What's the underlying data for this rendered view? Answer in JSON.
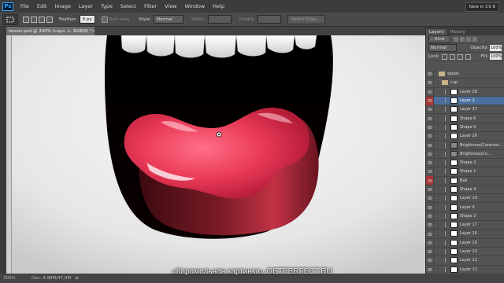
{
  "menu": {
    "logo": "Ps",
    "items": [
      "File",
      "Edit",
      "Image",
      "Layer",
      "Type",
      "Select",
      "Filter",
      "View",
      "Window",
      "Help"
    ],
    "new_in": "New in CS 6"
  },
  "options": {
    "feather_label": "Feather:",
    "feather_value": "0 px",
    "antialias_label": "Anti-alias",
    "style_label": "Style:",
    "style_value": "Normal",
    "width_label": "Width:",
    "height_label": "Height:",
    "refine_edge": "Refine Edge..."
  },
  "document": {
    "tab_title": "lesson.psd @ 300% (cup+ +, RGB/8) *",
    "close": "×"
  },
  "status": {
    "zoom": "300%",
    "doc_size": "Doc: 4,98M/47,0M",
    "arrow": "▶"
  },
  "caption": "«Карамельная картинка» GETPERFECT.RU",
  "panel": {
    "tabs": [
      "Layers",
      "History"
    ],
    "kind_label": "Kind",
    "blend_mode": "Normal",
    "opacity_label": "Opacity:",
    "opacity_value": "100%",
    "lock_label": "Lock:",
    "fill_label": "Fill:",
    "fill_value": "100%",
    "layers": [
      {
        "name": "spoon",
        "type": "folder"
      },
      {
        "name": "cup",
        "type": "folder"
      },
      {
        "name": "Layer 28",
        "type": "layer"
      },
      {
        "name": "Layer 2",
        "type": "layer",
        "selected": true
      },
      {
        "name": "Layer 27",
        "type": "layer"
      },
      {
        "name": "Shape 6",
        "type": "layer"
      },
      {
        "name": "Shape 5",
        "type": "layer"
      },
      {
        "name": "Layer 26",
        "type": "layer"
      },
      {
        "name": "Brightness/Contrast...",
        "type": "adj"
      },
      {
        "name": "Brightness/Co...",
        "type": "adj"
      },
      {
        "name": "Shape 2",
        "type": "layer"
      },
      {
        "name": "Shape 1",
        "type": "layer"
      },
      {
        "name": "Ball",
        "type": "layer"
      },
      {
        "name": "Shape 4",
        "type": "layer"
      },
      {
        "name": "Layer 10",
        "type": "layer"
      },
      {
        "name": "Layer 9",
        "type": "layer"
      },
      {
        "name": "Shape 3",
        "type": "layer"
      },
      {
        "name": "Layer 17",
        "type": "layer"
      },
      {
        "name": "Layer 16",
        "type": "layer"
      },
      {
        "name": "Layer 15",
        "type": "layer"
      },
      {
        "name": "Layer 13",
        "type": "layer"
      },
      {
        "name": "Layer 12",
        "type": "layer"
      },
      {
        "name": "Layer 11",
        "type": "layer"
      }
    ]
  }
}
